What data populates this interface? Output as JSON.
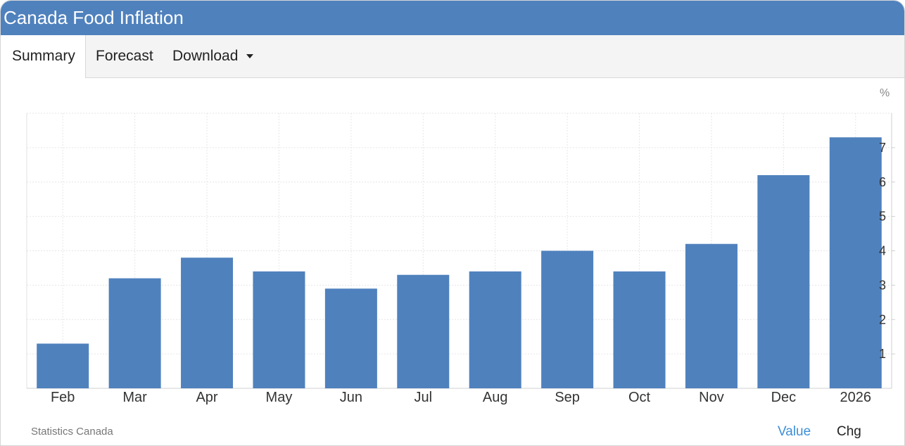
{
  "header": {
    "title": "Canada Food Inflation",
    "color": "#4f81bd"
  },
  "tabs": [
    {
      "label": "Summary",
      "active": true
    },
    {
      "label": "Forecast",
      "active": false
    },
    {
      "label": "Download",
      "active": false,
      "icon": "caret-down-icon"
    }
  ],
  "chart_data": {
    "type": "bar",
    "unit": "%",
    "categories": [
      "Feb",
      "Mar",
      "Apr",
      "May",
      "Jun",
      "Jul",
      "Aug",
      "Sep",
      "Oct",
      "Nov",
      "Dec",
      "2026"
    ],
    "values": [
      1.3,
      3.2,
      3.8,
      3.4,
      2.9,
      3.3,
      3.4,
      4.0,
      3.4,
      4.2,
      6.2,
      7.3
    ],
    "yticks": [
      1,
      2,
      3,
      4,
      5,
      6,
      7
    ],
    "ylim": [
      0,
      8
    ],
    "grid": true,
    "bar_color": "#4f81bd"
  },
  "footer": {
    "source": "Statistics Canada",
    "value_label": "Value",
    "chg_label": "Chg",
    "value_color": "#3d8fd8"
  }
}
